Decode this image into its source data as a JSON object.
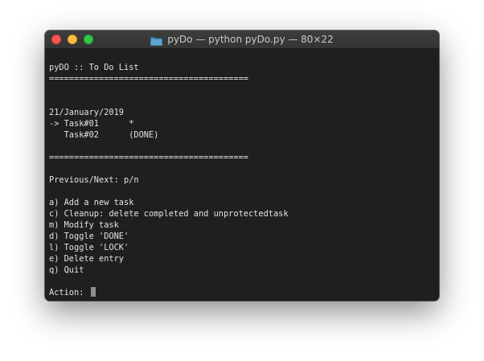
{
  "window": {
    "title": "pyDo — python pyDo.py — 80×22",
    "icon": "folder-icon"
  },
  "terminal": {
    "lines": [
      "pyDO :: To Do List",
      "========================================",
      "",
      "",
      "21/January/2019",
      "-> Task#01      *",
      "   Task#02      (DONE)",
      "",
      "========================================",
      "",
      "Previous/Next: p/n",
      "",
      "a) Add a new task",
      "c) Cleanup: delete completed and unprotectedtask",
      "m) Modify task",
      "d) Toggle 'DONE'",
      "l) Toggle 'LOCK'",
      "e) Delete entry",
      "q) Quit",
      ""
    ],
    "prompt": "Action: "
  },
  "colors": {
    "close": "#fc5753",
    "minimize": "#fdbc40",
    "zoom": "#33c748",
    "terminal_bg": "#1f1f1f",
    "text": "#e2e2e2"
  }
}
